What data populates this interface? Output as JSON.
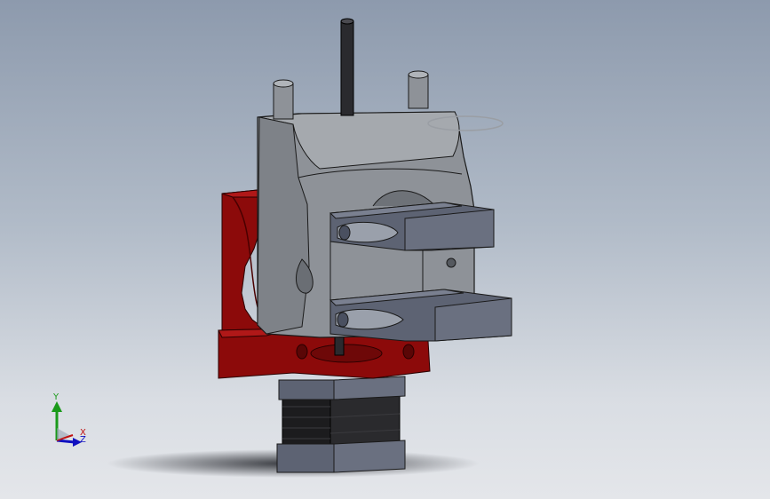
{
  "triad": {
    "y_label": "Y",
    "x_label": "X",
    "z_label": "Z"
  },
  "colors": {
    "background_top": "#8d9aad",
    "background_bottom": "#e4e6ea",
    "housing_gray": "#8e9298",
    "bracket_slate": "#5d6373",
    "part_red": "#8c0a0a",
    "motor_black": "#1c1c1e",
    "axis_x": "#c01010",
    "axis_y": "#1a9a1a",
    "axis_z": "#1010c0"
  }
}
